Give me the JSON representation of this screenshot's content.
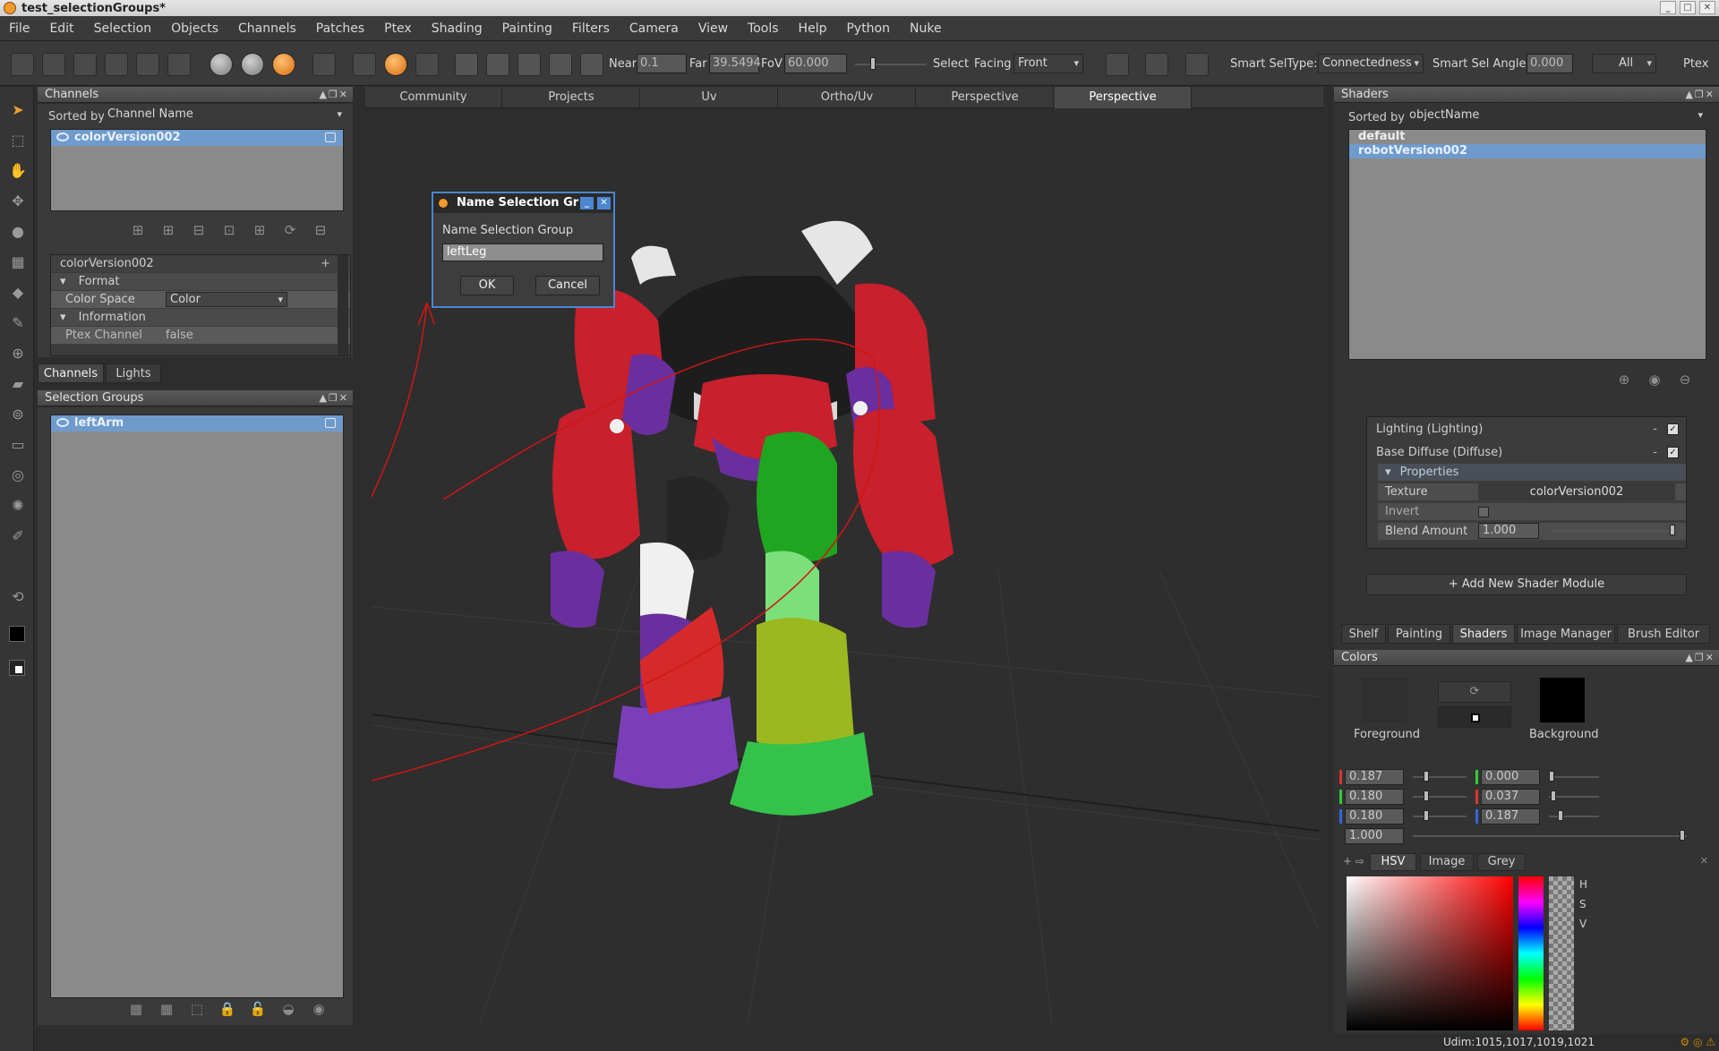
{
  "window": {
    "title": "test_selectionGroups*"
  },
  "menu": [
    "File",
    "Edit",
    "Selection",
    "Objects",
    "Channels",
    "Patches",
    "Ptex",
    "Shading",
    "Painting",
    "Filters",
    "Camera",
    "View",
    "Tools",
    "Help",
    "Python",
    "Nuke"
  ],
  "toolbar": {
    "near_label": "Near",
    "near_value": "0.1",
    "far_label": "Far",
    "far_value": "39.5494",
    "fov_label": "FoV",
    "fov_value": "60.000",
    "select_label": "Select",
    "facing_label": "Facing",
    "facing_value": "Front",
    "smart_seltype_label": "Smart SelType:",
    "smart_seltype_value": "Connectedness",
    "smart_angle_label": "Smart Sel Angle",
    "smart_angle_value": "0.000",
    "all_label": "All",
    "ptex_label": "Ptex"
  },
  "channels_panel": {
    "title": "Channels",
    "sorted_by_label": "Sorted by",
    "sorted_by_value": "Channel Name",
    "items": [
      "colorVersion002"
    ],
    "props_title": "colorVersion002",
    "format_label": "Format",
    "color_space_label": "Color Space",
    "color_space_value": "Color",
    "information_label": "Information",
    "ptex_channel_label": "Ptex Channel",
    "ptex_channel_value": "false",
    "tabs": [
      "Channels",
      "Lights"
    ]
  },
  "selection_groups": {
    "title": "Selection Groups",
    "items": [
      "leftArm"
    ]
  },
  "viewport_tabs": [
    "Community",
    "Projects",
    "Uv",
    "Ortho/Uv",
    "Perspective",
    "Perspective"
  ],
  "dialog": {
    "title": "Name Selection Gr",
    "label": "Name Selection Group",
    "value": "leftLeg",
    "ok": "OK",
    "cancel": "Cancel"
  },
  "shaders_panel": {
    "title": "Shaders",
    "sorted_by_label": "Sorted by",
    "sorted_by_value": "objectName",
    "items": [
      "default",
      "robotVersion002"
    ],
    "lighting": "Lighting (Lighting)",
    "base_diffuse": "Base Diffuse (Diffuse)",
    "properties": "Properties",
    "texture_label": "Texture",
    "texture_value": "colorVersion002",
    "invert_label": "Invert",
    "blend_label": "Blend Amount",
    "blend_value": "1.000",
    "add_module": "Add New Shader Module",
    "tabs": [
      "Shelf",
      "Painting",
      "Shaders",
      "Image Manager",
      "Brush Editor"
    ]
  },
  "colors_panel": {
    "title": "Colors",
    "foreground_label": "Foreground",
    "background_label": "Background",
    "fg_values": [
      "0.187",
      "0.180",
      "0.180",
      "1.000"
    ],
    "bg_values": [
      "0.000",
      "0.037",
      "0.187"
    ],
    "tabs": [
      "HSV",
      "Image",
      "Grey"
    ],
    "hsv_labels": [
      "H",
      "S",
      "V"
    ],
    "foreground_color": "#2f2f30",
    "background_color": "#000000"
  },
  "status": {
    "udim": "Udim:1015,1017,1019,1021"
  }
}
